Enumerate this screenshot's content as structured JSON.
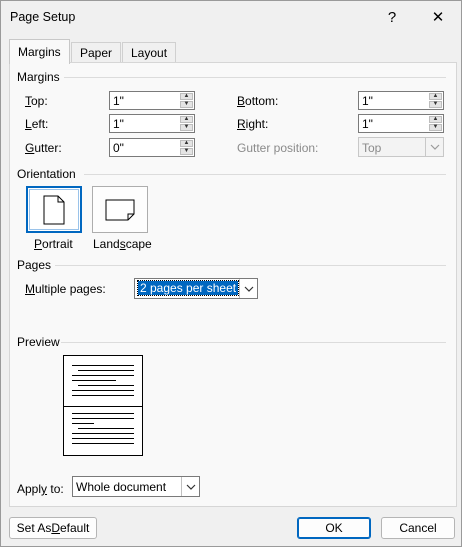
{
  "window": {
    "title": "Page Setup",
    "help_label": "?",
    "close_label": "✕"
  },
  "tabs": [
    {
      "label": "Margins",
      "active": true
    },
    {
      "label": "Paper",
      "active": false
    },
    {
      "label": "Layout",
      "active": false
    }
  ],
  "margins": {
    "section_label": "Margins",
    "top": {
      "label_u": "T",
      "label_rest": "op:",
      "value": "1\""
    },
    "bottom": {
      "label_u": "B",
      "label_rest": "ottom:",
      "value": "1\""
    },
    "left": {
      "label_u": "L",
      "label_rest": "eft:",
      "value": "1\""
    },
    "right": {
      "label_u": "R",
      "label_rest": "ight:",
      "value": "1\""
    },
    "gutter": {
      "label_u": "G",
      "label_rest": "utter:",
      "value": "0\""
    },
    "gutter_position": {
      "label": "Gutter position:",
      "value": "Top"
    }
  },
  "orientation": {
    "section_label": "Orientation",
    "portrait": {
      "label_u": "P",
      "label_rest": "ortrait",
      "selected": true
    },
    "landscape": {
      "label_pre": "Land",
      "label_u": "s",
      "label_rest": "cape",
      "selected": false
    }
  },
  "pages": {
    "section_label": "Pages",
    "multiple_pages_label_u": "M",
    "multiple_pages_label_rest": "ultiple pages:",
    "multiple_pages_value": "2 pages per sheet"
  },
  "preview": {
    "section_label": "Preview"
  },
  "apply_to": {
    "label_pre": "Appl",
    "label_u": "y",
    "label_rest": " to:",
    "value": "Whole document"
  },
  "footer": {
    "default_label_pre": "Set As ",
    "default_label_u": "D",
    "default_label_rest": "efault",
    "ok_label": "OK",
    "cancel_label": "Cancel"
  }
}
